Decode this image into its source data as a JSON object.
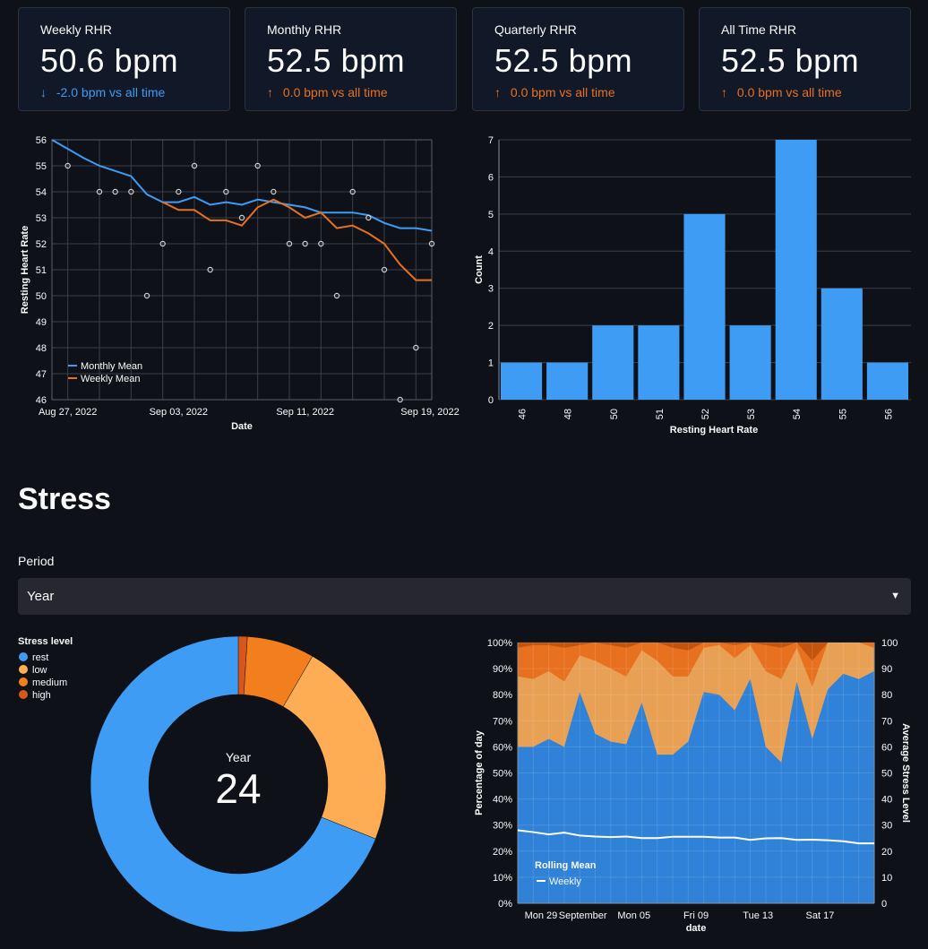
{
  "metrics": [
    {
      "label": "Weekly RHR",
      "value": "50.6 bpm",
      "delta": "-2.0 bpm vs all time",
      "direction": "down"
    },
    {
      "label": "Monthly RHR",
      "value": "52.5 bpm",
      "delta": "0.0 bpm vs all time",
      "direction": "up"
    },
    {
      "label": "Quarterly RHR",
      "value": "52.5 bpm",
      "delta": "0.0 bpm vs all time",
      "direction": "up"
    },
    {
      "label": "All Time RHR",
      "value": "52.5 bpm",
      "delta": "0.0 bpm vs all time",
      "direction": "up"
    }
  ],
  "colors": {
    "background": "#0e1117",
    "card": "#111827",
    "blue": "#3e9cf5",
    "orange": "#e8711f",
    "rest": "#3e9cf5",
    "low": "#ffad54",
    "medium": "#f27e1e",
    "high": "#d9571b"
  },
  "stress": {
    "heading": "Stress",
    "period_label": "Period",
    "period_value": "Year",
    "donut_label": "Year",
    "donut_value": "24"
  },
  "chart_data": [
    {
      "type": "line",
      "xlabel": "Date",
      "ylabel": "Resting Heart Rate",
      "ylim": [
        46,
        56
      ],
      "xlim": [
        "2022-08-26",
        "2022-09-19"
      ],
      "x_ticks": [
        "Aug 27, 2022",
        "Sep 03, 2022",
        "Sep 11, 2022",
        "Sep 19, 2022"
      ],
      "y_ticks": [
        46,
        47,
        48,
        49,
        50,
        51,
        52,
        53,
        54,
        55,
        56
      ],
      "grid": true,
      "legend_position": "bottom-left",
      "points": {
        "x": [
          "2022-08-27",
          "2022-08-29",
          "2022-08-30",
          "2022-08-31",
          "2022-09-01",
          "2022-09-02",
          "2022-09-03",
          "2022-09-04",
          "2022-09-05",
          "2022-09-06",
          "2022-09-07",
          "2022-09-08",
          "2022-09-09",
          "2022-09-10",
          "2022-09-11",
          "2022-09-12",
          "2022-09-13",
          "2022-09-14",
          "2022-09-15",
          "2022-09-16",
          "2022-09-17",
          "2022-09-18",
          "2022-09-19"
        ],
        "y": [
          55,
          54,
          54,
          54,
          50,
          52,
          54,
          55,
          51,
          54,
          53,
          55,
          54,
          52,
          52,
          52,
          50,
          54,
          53,
          51,
          46,
          48,
          52
        ]
      },
      "series": [
        {
          "name": "Monthly Mean",
          "x": [
            "2022-08-26",
            "2022-08-28",
            "2022-08-29",
            "2022-08-30",
            "2022-08-31",
            "2022-09-01",
            "2022-09-02",
            "2022-09-03",
            "2022-09-04",
            "2022-09-05",
            "2022-09-06",
            "2022-09-07",
            "2022-09-08",
            "2022-09-09",
            "2022-09-10",
            "2022-09-11",
            "2022-09-12",
            "2022-09-13",
            "2022-09-14",
            "2022-09-15",
            "2022-09-16",
            "2022-09-17",
            "2022-09-18",
            "2022-09-19"
          ],
          "values": [
            56,
            55.3,
            55,
            54.8,
            54.6,
            53.9,
            53.6,
            53.6,
            53.8,
            53.5,
            53.6,
            53.5,
            53.7,
            53.6,
            53.5,
            53.4,
            53.2,
            53.2,
            53.2,
            53.1,
            52.8,
            52.6,
            52.6,
            52.5
          ]
        },
        {
          "name": "Weekly Mean",
          "x": [
            "2022-09-02",
            "2022-09-03",
            "2022-09-04",
            "2022-09-05",
            "2022-09-06",
            "2022-09-07",
            "2022-09-08",
            "2022-09-09",
            "2022-09-10",
            "2022-09-11",
            "2022-09-12",
            "2022-09-13",
            "2022-09-14",
            "2022-09-15",
            "2022-09-16",
            "2022-09-17",
            "2022-09-18",
            "2022-09-19"
          ],
          "values": [
            53.6,
            53.3,
            53.3,
            52.9,
            52.9,
            52.7,
            53.4,
            53.7,
            53.4,
            53,
            53.2,
            52.6,
            52.7,
            52.4,
            52,
            51.2,
            50.6,
            50.6
          ]
        }
      ]
    },
    {
      "type": "bar",
      "xlabel": "Resting Heart Rate",
      "ylabel": "Count",
      "categories": [
        "46",
        "48",
        "50",
        "51",
        "52",
        "53",
        "54",
        "55",
        "56"
      ],
      "values": [
        1,
        1,
        2,
        2,
        5,
        2,
        7,
        3,
        1
      ],
      "ylim": [
        0,
        7
      ],
      "y_ticks": [
        0,
        1,
        2,
        3,
        4,
        5,
        6,
        7
      ],
      "grid": true
    },
    {
      "type": "pie",
      "legend_title": "Stress level",
      "legend_position": "top-left",
      "labels": [
        "rest",
        "low",
        "medium",
        "high"
      ],
      "values": [
        70,
        23,
        7.5,
        1
      ],
      "center_label": "Year",
      "center_value": "24"
    },
    {
      "type": "area",
      "xlabel": "date",
      "ylabel": "Percentage of day",
      "y2label": "Average Stress Level",
      "ylim": [
        0,
        100
      ],
      "y2lim": [
        0,
        100
      ],
      "y_ticks": [
        "0%",
        "10%",
        "20%",
        "30%",
        "40%",
        "50%",
        "60%",
        "70%",
        "80%",
        "90%",
        "100%"
      ],
      "y2_ticks": [
        0,
        10,
        20,
        30,
        40,
        50,
        60,
        70,
        80,
        90,
        100
      ],
      "x_ticks": [
        "Mon 29",
        "September",
        "Mon 05",
        "Fri 09",
        "Tue 13",
        "Sat 17"
      ],
      "x": [
        "2022-08-28",
        "2022-08-29",
        "2022-08-30",
        "2022-08-31",
        "2022-09-01",
        "2022-09-02",
        "2022-09-03",
        "2022-09-04",
        "2022-09-05",
        "2022-09-06",
        "2022-09-07",
        "2022-09-08",
        "2022-09-09",
        "2022-09-10",
        "2022-09-11",
        "2022-09-12",
        "2022-09-13",
        "2022-09-14",
        "2022-09-15",
        "2022-09-16",
        "2022-09-17",
        "2022-09-18",
        "2022-09-19"
      ],
      "series": [
        {
          "name": "rest",
          "values": [
            60,
            60,
            63,
            60,
            81,
            65,
            62,
            61,
            77,
            57,
            57,
            62,
            81,
            80,
            74,
            86,
            60,
            54,
            85,
            63,
            82,
            88,
            86,
            89
          ]
        },
        {
          "name": "low",
          "values": [
            87,
            86,
            89,
            85,
            95,
            93,
            90,
            87,
            97,
            93,
            87,
            87,
            98,
            99,
            94,
            99,
            89,
            86,
            98,
            83,
            100,
            100,
            100,
            98
          ]
        },
        {
          "name": "medium",
          "values": [
            98,
            99,
            99,
            98,
            99,
            100,
            99,
            98,
            100,
            100,
            98,
            97,
            100,
            100,
            99,
            100,
            99,
            98,
            100,
            93,
            100,
            100,
            100,
            100
          ]
        },
        {
          "name": "high",
          "values": [
            100,
            100,
            100,
            100,
            100,
            100,
            100,
            100,
            100,
            100,
            100,
            100,
            100,
            100,
            100,
            100,
            100,
            100,
            100,
            100,
            100,
            100,
            100,
            100
          ]
        }
      ],
      "rolling_mean": {
        "legend_title": "Rolling Mean",
        "name": "Weekly",
        "values": [
          28,
          27.3,
          26.4,
          27.1,
          26,
          25.6,
          25.4,
          25.6,
          25,
          25,
          25.5,
          25.5,
          25.5,
          25.2,
          25.2,
          24.3,
          24.9,
          25,
          24.3,
          24.4,
          24.2,
          23.8,
          23,
          23
        ]
      }
    }
  ]
}
